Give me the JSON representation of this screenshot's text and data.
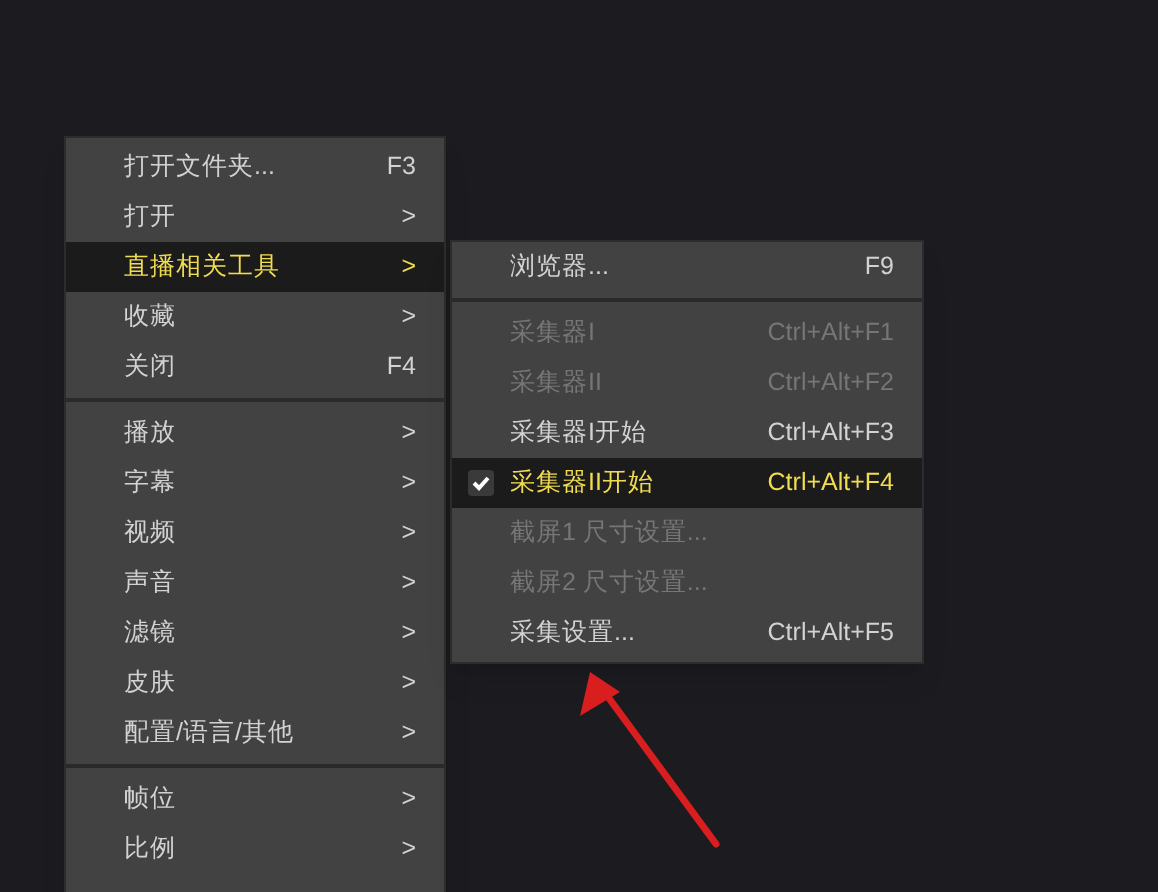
{
  "menu": {
    "items": [
      {
        "kind": "item",
        "label": "打开文件夹...",
        "shortcut": "F3",
        "selected": false
      },
      {
        "kind": "item",
        "label": "打开",
        "shortcut": ">",
        "selected": false
      },
      {
        "kind": "item",
        "label": "直播相关工具",
        "shortcut": ">",
        "selected": true
      },
      {
        "kind": "item",
        "label": "收藏",
        "shortcut": ">",
        "selected": false
      },
      {
        "kind": "item",
        "label": "关闭",
        "shortcut": "F4",
        "selected": false
      },
      {
        "kind": "separator"
      },
      {
        "kind": "item",
        "label": "播放",
        "shortcut": ">",
        "selected": false
      },
      {
        "kind": "item",
        "label": "字幕",
        "shortcut": ">",
        "selected": false
      },
      {
        "kind": "item",
        "label": "视频",
        "shortcut": ">",
        "selected": false
      },
      {
        "kind": "item",
        "label": "声音",
        "shortcut": ">",
        "selected": false
      },
      {
        "kind": "item",
        "label": "滤镜",
        "shortcut": ">",
        "selected": false
      },
      {
        "kind": "item",
        "label": "皮肤",
        "shortcut": ">",
        "selected": false
      },
      {
        "kind": "item",
        "label": "配置/语言/其他",
        "shortcut": ">",
        "selected": false
      },
      {
        "kind": "separator"
      },
      {
        "kind": "item",
        "label": "帧位",
        "shortcut": ">",
        "selected": false
      },
      {
        "kind": "item",
        "label": "比例",
        "shortcut": ">",
        "selected": false
      }
    ]
  },
  "submenu": {
    "items": [
      {
        "kind": "item",
        "label": "浏览器...",
        "shortcut": "F9",
        "selected": false,
        "disabled": false,
        "checked": false
      },
      {
        "kind": "separator"
      },
      {
        "kind": "item",
        "label": "采集器I",
        "shortcut": "Ctrl+Alt+F1",
        "selected": false,
        "disabled": true,
        "checked": false
      },
      {
        "kind": "item",
        "label": "采集器II",
        "shortcut": "Ctrl+Alt+F2",
        "selected": false,
        "disabled": true,
        "checked": false
      },
      {
        "kind": "item",
        "label": "采集器I开始",
        "shortcut": "Ctrl+Alt+F3",
        "selected": false,
        "disabled": false,
        "checked": false
      },
      {
        "kind": "item",
        "label": "采集器II开始",
        "shortcut": "Ctrl+Alt+F4",
        "selected": true,
        "disabled": false,
        "checked": true
      },
      {
        "kind": "item",
        "label": "截屏1 尺寸设置...",
        "selected": false,
        "disabled": true,
        "checked": false
      },
      {
        "kind": "item",
        "label": "截屏2 尺寸设置...",
        "selected": false,
        "disabled": true,
        "checked": false
      },
      {
        "kind": "item",
        "label": "采集设置...",
        "shortcut": "Ctrl+Alt+F5",
        "selected": false,
        "disabled": false,
        "checked": false
      }
    ]
  }
}
